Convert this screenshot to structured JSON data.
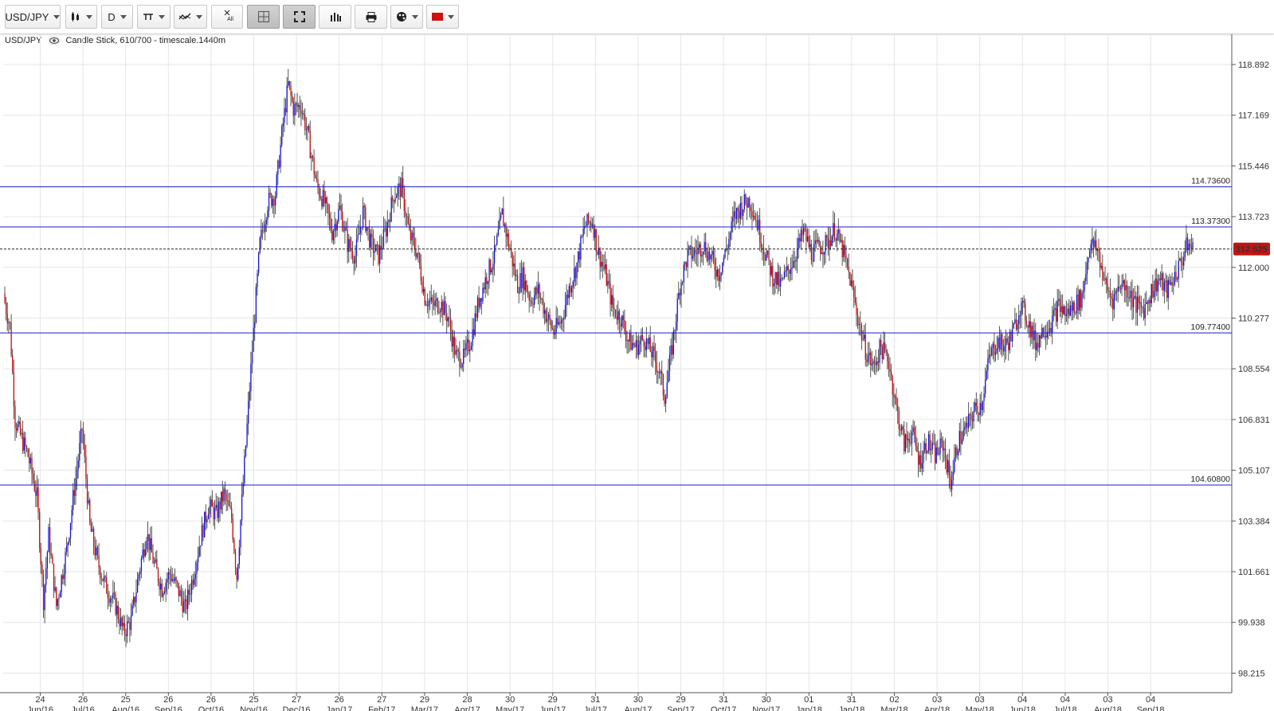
{
  "toolbar": {
    "symbol": "USD/JPY",
    "interval": "D",
    "buttons": [
      {
        "name": "chart-type-button",
        "icon": "candlestick-icon"
      },
      {
        "name": "interval-button",
        "icon": "interval"
      },
      {
        "name": "drawing-tools-button",
        "icon": "drawing-icon"
      },
      {
        "name": "indicators-button",
        "icon": "indicators-icon"
      },
      {
        "name": "remove-all-button",
        "icon": "remove-all-icon"
      },
      {
        "name": "crosshair-button",
        "icon": "crosshair-icon"
      },
      {
        "name": "fullscreen-button",
        "icon": "fullscreen-icon"
      },
      {
        "name": "volume-button",
        "icon": "bar-chart-icon"
      },
      {
        "name": "print-button",
        "icon": "printer-icon"
      },
      {
        "name": "theme-button",
        "icon": "palette-icon"
      },
      {
        "name": "color-button",
        "icon": "color-swatch-icon"
      }
    ],
    "remove_all_label": "All"
  },
  "info": {
    "symbol": "USD/JPY",
    "description": "Candle Stick, 610/700 - timescale.1440m"
  },
  "chart_data": {
    "type": "candlestick",
    "symbol": "USD/JPY",
    "timescale": "1440m",
    "ylim": [
      97.5,
      120.3
    ],
    "y_ticks": [
      "118.892",
      "117.169",
      "115.446",
      "113.723",
      "112.000",
      "110.277",
      "108.554",
      "106.831",
      "105.107",
      "103.384",
      "101.661",
      "99.938",
      "98.215"
    ],
    "x_ticks": [
      {
        "day": "24",
        "month": "Jun/16"
      },
      {
        "day": "26",
        "month": "Jul/16"
      },
      {
        "day": "25",
        "month": "Aug/16"
      },
      {
        "day": "26",
        "month": "Sep/16"
      },
      {
        "day": "26",
        "month": "Oct/16"
      },
      {
        "day": "25",
        "month": "Nov/16"
      },
      {
        "day": "27",
        "month": "Dec/16"
      },
      {
        "day": "26",
        "month": "Jan/17"
      },
      {
        "day": "27",
        "month": "Feb/17"
      },
      {
        "day": "29",
        "month": "Mar/17"
      },
      {
        "day": "28",
        "month": "Apr/17"
      },
      {
        "day": "30",
        "month": "May/17"
      },
      {
        "day": "29",
        "month": "Jun/17"
      },
      {
        "day": "31",
        "month": "Jul/17"
      },
      {
        "day": "30",
        "month": "Aug/17"
      },
      {
        "day": "29",
        "month": "Sep/17"
      },
      {
        "day": "31",
        "month": "Oct/17"
      },
      {
        "day": "30",
        "month": "Nov/17"
      },
      {
        "day": "01",
        "month": "Jan/18"
      },
      {
        "day": "31",
        "month": "Jan/18"
      },
      {
        "day": "02",
        "month": "Mar/18"
      },
      {
        "day": "03",
        "month": "Apr/18"
      },
      {
        "day": "03",
        "month": "May/18"
      },
      {
        "day": "04",
        "month": "Jun/18"
      },
      {
        "day": "04",
        "month": "Jul/18"
      },
      {
        "day": "03",
        "month": "Aug/18"
      },
      {
        "day": "04",
        "month": "Sep/18"
      }
    ],
    "horizontal_levels": [
      {
        "label": "114.73600",
        "value": 114.736
      },
      {
        "label": "113.37300",
        "value": 113.373
      },
      {
        "label": "109.77400",
        "value": 109.774
      },
      {
        "label": "104.60800",
        "value": 104.608
      }
    ],
    "current_price": {
      "label": "112.625",
      "value": 112.625
    },
    "close_path": [
      [
        0,
        110.8
      ],
      [
        4,
        110.0
      ],
      [
        8,
        106.8
      ],
      [
        12,
        106.3
      ],
      [
        18,
        105.6
      ],
      [
        25,
        104.2
      ],
      [
        30,
        100.7
      ],
      [
        34,
        102.9
      ],
      [
        40,
        100.5
      ],
      [
        48,
        102.4
      ],
      [
        54,
        104.5
      ],
      [
        60,
        106.5
      ],
      [
        66,
        103.2
      ],
      [
        72,
        102.0
      ],
      [
        78,
        101.2
      ],
      [
        86,
        100.5
      ],
      [
        92,
        99.6
      ],
      [
        98,
        100.0
      ],
      [
        104,
        101.6
      ],
      [
        110,
        103.0
      ],
      [
        116,
        101.9
      ],
      [
        122,
        101.1
      ],
      [
        128,
        101.6
      ],
      [
        134,
        101.1
      ],
      [
        140,
        100.4
      ],
      [
        146,
        101.5
      ],
      [
        152,
        102.8
      ],
      [
        158,
        103.9
      ],
      [
        164,
        103.6
      ],
      [
        170,
        104.3
      ],
      [
        176,
        103.5
      ],
      [
        180,
        101.5
      ],
      [
        186,
        105.3
      ],
      [
        192,
        109.2
      ],
      [
        198,
        112.8
      ],
      [
        204,
        114.2
      ],
      [
        210,
        114.5
      ],
      [
        216,
        116.9
      ],
      [
        220,
        118.2
      ],
      [
        224,
        117.4
      ],
      [
        230,
        117.5
      ],
      [
        236,
        116.3
      ],
      [
        242,
        114.8
      ],
      [
        248,
        114.2
      ],
      [
        254,
        113.2
      ],
      [
        260,
        114.0
      ],
      [
        266,
        112.8
      ],
      [
        272,
        112.4
      ],
      [
        278,
        113.9
      ],
      [
        284,
        112.8
      ],
      [
        290,
        112.4
      ],
      [
        296,
        113.3
      ],
      [
        302,
        114.5
      ],
      [
        308,
        114.7
      ],
      [
        314,
        113.1
      ],
      [
        320,
        112.5
      ],
      [
        326,
        111.0
      ],
      [
        332,
        110.7
      ],
      [
        338,
        110.8
      ],
      [
        344,
        110.3
      ],
      [
        350,
        109.0
      ],
      [
        356,
        108.9
      ],
      [
        362,
        109.6
      ],
      [
        368,
        110.9
      ],
      [
        374,
        111.7
      ],
      [
        380,
        112.4
      ],
      [
        386,
        113.8
      ],
      [
        392,
        112.6
      ],
      [
        398,
        111.4
      ],
      [
        402,
        111.7
      ],
      [
        408,
        110.9
      ],
      [
        414,
        111.2
      ],
      [
        420,
        110.4
      ],
      [
        426,
        109.8
      ],
      [
        432,
        110.2
      ],
      [
        438,
        111.3
      ],
      [
        444,
        112.1
      ],
      [
        450,
        113.4
      ],
      [
        456,
        113.6
      ],
      [
        460,
        112.6
      ],
      [
        466,
        111.8
      ],
      [
        472,
        110.6
      ],
      [
        478,
        110.3
      ],
      [
        484,
        109.5
      ],
      [
        490,
        109.3
      ],
      [
        496,
        109.6
      ],
      [
        502,
        109.1
      ],
      [
        508,
        108.5
      ],
      [
        512,
        107.6
      ],
      [
        518,
        109.3
      ],
      [
        524,
        111.4
      ],
      [
        530,
        112.4
      ],
      [
        536,
        112.5
      ],
      [
        542,
        112.8
      ],
      [
        548,
        112.3
      ],
      [
        554,
        111.8
      ],
      [
        560,
        112.6
      ],
      [
        566,
        113.7
      ],
      [
        572,
        114.1
      ],
      [
        578,
        114.3
      ],
      [
        584,
        113.5
      ],
      [
        590,
        112.5
      ],
      [
        596,
        111.7
      ],
      [
        602,
        111.4
      ],
      [
        608,
        111.9
      ],
      [
        614,
        112.5
      ],
      [
        620,
        113.2
      ],
      [
        626,
        112.5
      ],
      [
        632,
        112.7
      ],
      [
        638,
        112.8
      ],
      [
        644,
        113.3
      ],
      [
        650,
        112.6
      ],
      [
        656,
        111.6
      ],
      [
        662,
        110.3
      ],
      [
        668,
        109.2
      ],
      [
        674,
        108.6
      ],
      [
        680,
        109.3
      ],
      [
        686,
        108.8
      ],
      [
        692,
        107.2
      ],
      [
        698,
        106.0
      ],
      [
        704,
        106.4
      ],
      [
        710,
        105.4
      ],
      [
        716,
        106.1
      ],
      [
        722,
        105.6
      ],
      [
        728,
        106.0
      ],
      [
        734,
        104.7
      ],
      [
        740,
        106.1
      ],
      [
        746,
        106.5
      ],
      [
        752,
        107.1
      ],
      [
        758,
        107.4
      ],
      [
        764,
        108.9
      ],
      [
        770,
        109.5
      ],
      [
        776,
        109.3
      ],
      [
        782,
        109.7
      ],
      [
        788,
        110.7
      ],
      [
        794,
        110.2
      ],
      [
        800,
        109.4
      ],
      [
        806,
        109.9
      ],
      [
        812,
        110.1
      ],
      [
        818,
        110.7
      ],
      [
        824,
        110.4
      ],
      [
        830,
        110.7
      ],
      [
        836,
        111.0
      ],
      [
        842,
        112.8
      ],
      [
        848,
        112.6
      ],
      [
        854,
        111.4
      ],
      [
        860,
        110.9
      ],
      [
        866,
        111.5
      ],
      [
        872,
        111.2
      ],
      [
        878,
        110.7
      ],
      [
        884,
        110.6
      ],
      [
        890,
        111.2
      ],
      [
        896,
        111.6
      ],
      [
        902,
        111.2
      ],
      [
        908,
        111.7
      ],
      [
        914,
        112.3
      ],
      [
        918,
        112.8
      ],
      [
        922,
        112.6
      ]
    ]
  }
}
